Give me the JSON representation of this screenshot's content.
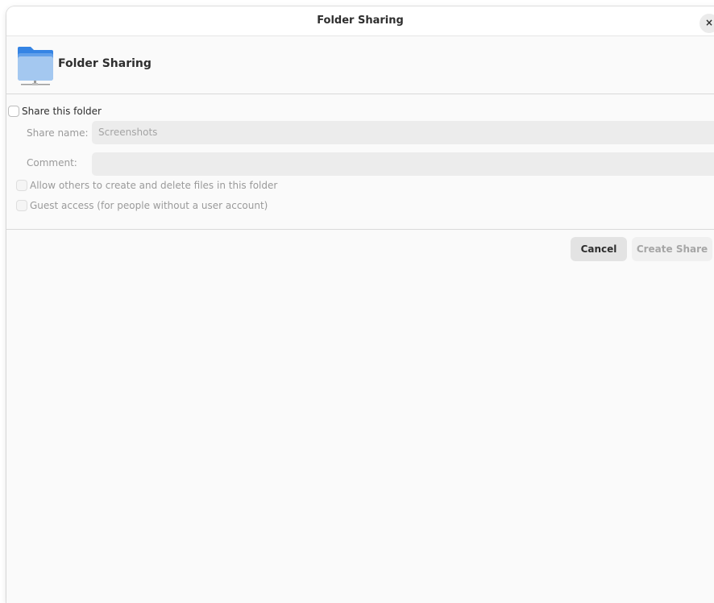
{
  "window": {
    "title": "Folder Sharing",
    "close_glyph": "×"
  },
  "header": {
    "title": "Folder Sharing",
    "icon": "folder-remote-icon"
  },
  "share_checkbox": {
    "label": "Share this folder",
    "checked": false
  },
  "share_name": {
    "label": "Share name:",
    "value": "Screenshots"
  },
  "comment": {
    "label": "Comment:",
    "value": ""
  },
  "allow_others": {
    "label": "Allow others to create and delete files in this folder",
    "checked": false
  },
  "guest_access": {
    "label": "Guest access (for people without a user account)",
    "checked": false
  },
  "buttons": {
    "cancel": "Cancel",
    "create_share": "Create Share"
  },
  "colors": {
    "folder_blue": "#62a0ea",
    "folder_light": "#a4c8f0"
  }
}
